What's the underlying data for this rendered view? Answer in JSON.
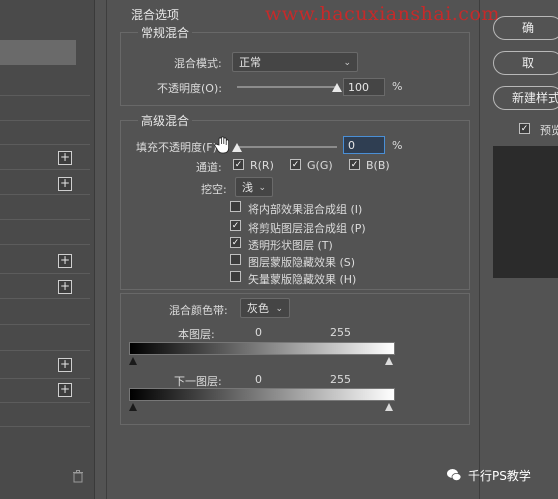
{
  "title": "混合选项",
  "watermark": "www.hacuxianshai.com",
  "general_blending": {
    "legend": "常规混合",
    "mode_label": "混合模式:",
    "mode_value": "正常",
    "opacity_label": "不透明度(O):",
    "opacity_value": "100",
    "opacity_percent": 100,
    "percent": "%"
  },
  "advanced_blending": {
    "legend": "高级混合",
    "fill_opacity_label": "填充不透明度(F):",
    "fill_opacity_value": "0",
    "fill_opacity_percent": 0,
    "percent": "%",
    "channels_label": "通道:",
    "channels": [
      {
        "label": "R(R)",
        "checked": true
      },
      {
        "label": "G(G)",
        "checked": true
      },
      {
        "label": "B(B)",
        "checked": true
      }
    ],
    "knockout_label": "挖空:",
    "knockout_value": "浅",
    "options": [
      {
        "label": "将内部效果混合成组 (I)",
        "checked": false
      },
      {
        "label": "将剪贴图层混合成组 (P)",
        "checked": true
      },
      {
        "label": "透明形状图层 (T)",
        "checked": true
      },
      {
        "label": "图层蒙版隐藏效果 (S)",
        "checked": false
      },
      {
        "label": "矢量蒙版隐藏效果 (H)",
        "checked": false
      }
    ]
  },
  "blend_if": {
    "label": "混合颜色带:",
    "value": "灰色",
    "this_layer": {
      "label": "本图层:",
      "min": "0",
      "max": "255"
    },
    "underlying_layer": {
      "label": "下一图层:",
      "min": "0",
      "max": "255"
    }
  },
  "right_buttons": {
    "ok": "确",
    "cancel": "取",
    "new_style": "新建样式",
    "preview_label": "预览",
    "preview_checked": true
  },
  "credit": "千行PS教学",
  "icons": {
    "plus": "+",
    "trash": "trash-icon",
    "check": "✓",
    "chevron": "⌄"
  }
}
